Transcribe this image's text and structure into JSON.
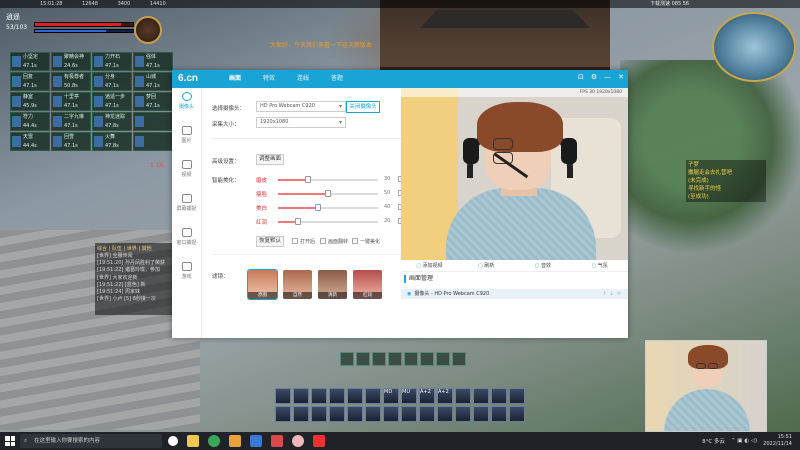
{
  "game": {
    "top_hud": [
      "15:01:28",
      "12648",
      "3400",
      "14410"
    ],
    "player_name": "逍遥",
    "player_level": "53/103",
    "gold_text": "大家好，今天我们来看一下这次新版本",
    "red_text": "1 1A",
    "buffs": [
      {
        "name": "小坚定",
        "value": "47.1s"
      },
      {
        "name": "聚精会神",
        "value": "24.6s"
      },
      {
        "name": "力开石",
        "value": "47.1s"
      },
      {
        "name": "强体",
        "value": "47.1s"
      },
      {
        "name": "回复",
        "value": "47.1s"
      },
      {
        "name": "有极尊者",
        "value": "50.8s"
      },
      {
        "name": "分身",
        "value": "47.1s"
      },
      {
        "name": "山城",
        "value": "47.1s"
      },
      {
        "name": "静室",
        "value": "45.9s"
      },
      {
        "name": "十里亭",
        "value": "47.1s"
      },
      {
        "name": "逍遥一步",
        "value": "47.1s"
      },
      {
        "name": "梦回",
        "value": "47.1s"
      },
      {
        "name": "符力",
        "value": "44.4s"
      },
      {
        "name": "二字九琳",
        "value": "47.1s"
      },
      {
        "name": "神龙迷踪",
        "value": "47.8s"
      },
      {
        "name": "",
        "value": ""
      },
      {
        "name": "天雷",
        "value": "44.4s"
      },
      {
        "name": "回雪",
        "value": "47.1s"
      },
      {
        "name": "火舞",
        "value": "47.8s"
      },
      {
        "name": "",
        "value": ""
      }
    ],
    "chat": {
      "tabs": "综合 | 队伍 | 世界 | 其他",
      "lines": [
        "[世界] 全服传闻",
        "[19:51:20] 孙丹凤胜利了荣获",
        "[19:51:22] 诸葛玲珑，参加",
        "[世界] 大家欢迎新",
        "[19:51:22] [蓝色] 新",
        "[19:51:24] 周家妹",
        "[世界] 小卢 [5] 8秒接一次"
      ]
    },
    "minimap_hud": "下载测速 085 56",
    "quest_lines": [
      "子梦",
      "撒腿走会去扎营吧",
      "(未完成)",
      "寻找新手的怪",
      "(至成功)"
    ],
    "skill_labels": [
      "MD",
      "MU",
      "A+2",
      "A+2"
    ],
    "midbar_count": 8
  },
  "dialog": {
    "logo": "6.cn",
    "tabs": [
      "画面",
      "特效",
      "连线",
      "答题"
    ],
    "active_tab": 0,
    "window_controls": [
      "⊡",
      "⚙",
      "—",
      "✕"
    ],
    "sidebar": [
      {
        "label": "摄像头",
        "icon": "camera-icon"
      },
      {
        "label": "图片",
        "icon": "image-icon"
      },
      {
        "label": "视频",
        "icon": "video-icon"
      },
      {
        "label": "屏幕捕捉",
        "icon": "screen-icon"
      },
      {
        "label": "窗口捕捉",
        "icon": "window-icon"
      },
      {
        "label": "游戏",
        "icon": "game-icon"
      }
    ],
    "camera": {
      "select_label": "选择摄像头：",
      "select_value": "HD Pro Webcam C920",
      "close_button": "关闭摄像头",
      "resolution_label": "采集大小：",
      "resolution_value": "1920x1080"
    },
    "advanced": {
      "label": "高级设置：",
      "button": "调整画面"
    },
    "beauty": {
      "label": "智能美化：",
      "sliders": [
        {
          "name": "磨皮",
          "value": 30,
          "max": 100
        },
        {
          "name": "瘦脸",
          "value": 50,
          "max": 100
        },
        {
          "name": "美白",
          "value": 40,
          "max": 100
        },
        {
          "name": "红润",
          "value": 20,
          "max": 100
        }
      ],
      "reset_button": "恢复默认",
      "options": [
        "打开后",
        "画面翻转",
        "一键美化"
      ]
    },
    "filter": {
      "label": "滤镜：",
      "items": [
        "原图",
        "自然",
        "清新",
        "红润"
      ]
    },
    "preview": {
      "status": "FPS 30  1920x1080"
    },
    "toolbar": [
      "添加视频",
      "刷新",
      "音效",
      "气氛"
    ],
    "scene": {
      "title": "画面管理",
      "item": "摄像头 - HD Pro Webcam C920"
    }
  },
  "taskbar": {
    "search_placeholder": "在这里输入你要搜索的内容",
    "weather": "8°C  多云",
    "time": "15:51",
    "date": "2022/11/14"
  }
}
